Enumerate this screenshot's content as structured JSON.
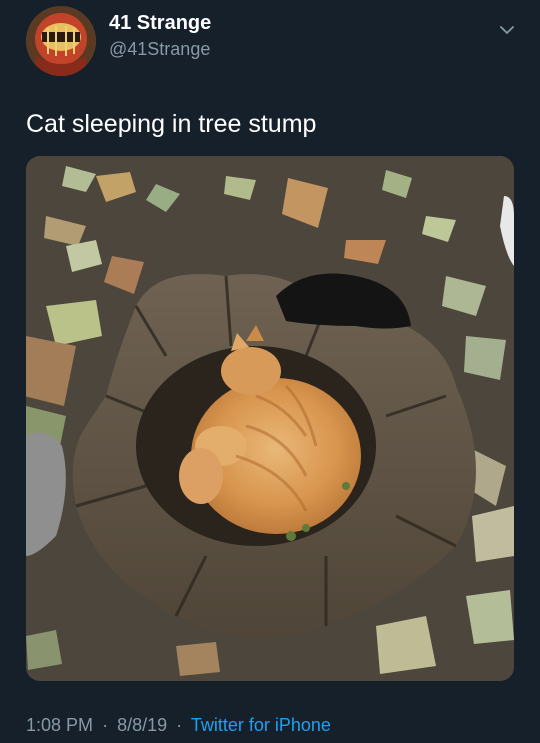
{
  "user": {
    "display_name": "41 Strange",
    "handle": "@41Strange"
  },
  "tweet": {
    "text": "Cat sleeping in tree stump",
    "time": "1:08 PM",
    "separator": "·",
    "date": "8/8/19",
    "source": "Twitter for iPhone"
  },
  "colors": {
    "background": "#15202b",
    "secondary_text": "#8899a6",
    "link": "#1da1f2"
  },
  "icons": {
    "more": "chevron-down-icon"
  }
}
